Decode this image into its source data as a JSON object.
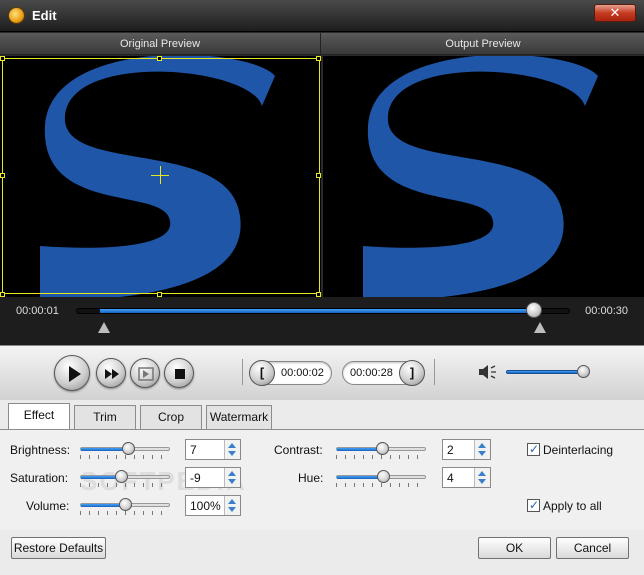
{
  "window": {
    "title": "Edit",
    "close_glyph": "✕"
  },
  "preview": {
    "original_label": "Original Preview",
    "output_label": "Output Preview",
    "letter": "S"
  },
  "timeline": {
    "start_time": "00:00:01",
    "end_time": "00:00:30",
    "progress": 0.93
  },
  "controls": {
    "trim_start": "00:00:02",
    "trim_end": "00:00:28",
    "volume_level": 0.9
  },
  "tabs": [
    {
      "label": "Effect",
      "active": true
    },
    {
      "label": "Trim",
      "active": false
    },
    {
      "label": "Crop",
      "active": false
    },
    {
      "label": "Watermark",
      "active": false
    }
  ],
  "effect": {
    "brightness": {
      "label": "Brightness:",
      "value": "7",
      "level": 0.55
    },
    "saturation": {
      "label": "Saturation:",
      "value": "-9",
      "level": 0.45
    },
    "volume": {
      "label": "Volume:",
      "value": "100%",
      "level": 0.5
    },
    "contrast": {
      "label": "Contrast:",
      "value": "2",
      "level": 0.52
    },
    "hue": {
      "label": "Hue:",
      "value": "4",
      "level": 0.53
    },
    "deinterlacing": {
      "label": "Deinterlacing",
      "checked": true
    },
    "apply_to_all": {
      "label": "Apply to all",
      "checked": true
    }
  },
  "watermark_overlay": "SOFTPEDIA",
  "buttons": {
    "restore": "Restore Defaults",
    "ok": "OK",
    "cancel": "Cancel"
  },
  "colors": {
    "accent": "#1c63b8",
    "logo_blue": "#1f56a8"
  }
}
